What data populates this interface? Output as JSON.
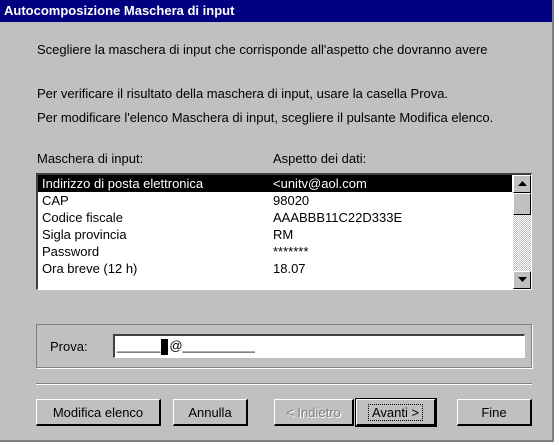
{
  "window": {
    "title": "Autocomposizione Maschera di input"
  },
  "instructions": {
    "line1": "Scegliere la maschera di input che corrisponde all'aspetto che dovranno avere",
    "line2": "Per verificare il risultato della maschera di input, usare la casella Prova.",
    "line3": "Per modificare l'elenco Maschera di input, scegliere il pulsante Modifica elenco."
  },
  "list": {
    "col1_header": "Maschera di input:",
    "col2_header": "Aspetto dei dati:",
    "rows": [
      {
        "mask": "Indirizzo di posta elettronica",
        "sample": "<unitv@aol.com",
        "selected": true
      },
      {
        "mask": "CAP",
        "sample": "98020",
        "selected": false
      },
      {
        "mask": "Codice fiscale",
        "sample": "AAABBB11C22D333E",
        "selected": false
      },
      {
        "mask": "Sigla provincia",
        "sample": "RM",
        "selected": false
      },
      {
        "mask": "Password",
        "sample": "*******",
        "selected": false
      },
      {
        "mask": "Ora breve (12 h)",
        "sample": "18.07",
        "selected": false
      }
    ]
  },
  "prova": {
    "label": "Prova:",
    "value_before": "______",
    "value_after": "@__________"
  },
  "buttons": {
    "modify": "Modifica elenco",
    "cancel": "Annulla",
    "back": "< Indietro",
    "next": "Avanti >",
    "finish": "Fine"
  },
  "icons": {
    "scroll_up": "up-arrow-icon",
    "scroll_down": "down-arrow-icon"
  }
}
